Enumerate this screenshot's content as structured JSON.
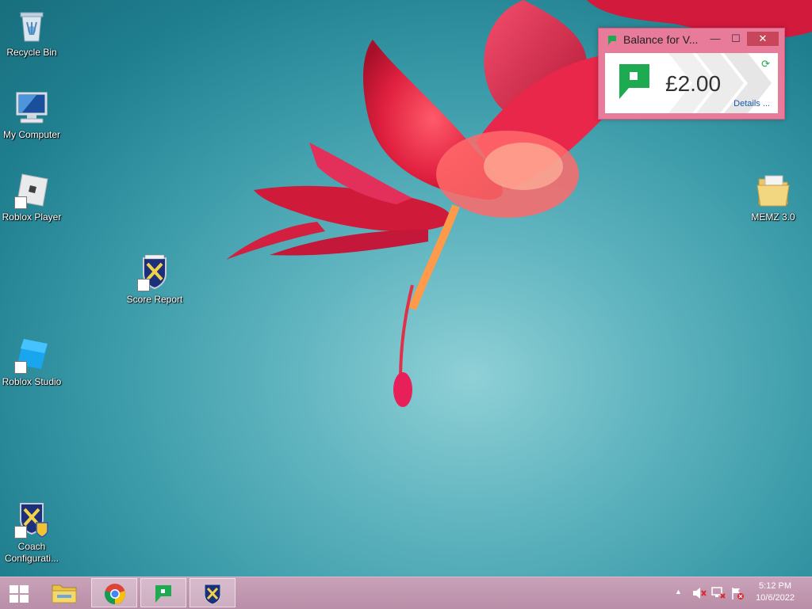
{
  "desktop": {
    "icons": [
      {
        "label": "Recycle Bin"
      },
      {
        "label": "My Computer"
      },
      {
        "label": "Roblox Player"
      },
      {
        "label": "Score Report"
      },
      {
        "label": "Roblox Studio"
      },
      {
        "label": "Coach Configurati..."
      },
      {
        "label": "MEMZ 3.0"
      }
    ]
  },
  "widget": {
    "title": "Balance for V...",
    "amount": "£2.00",
    "details_link": "Details ...",
    "minimize_glyph": "—",
    "maximize_glyph": "☐",
    "close_glyph": "✕",
    "accent_color": "#e87a9a",
    "brand_color": "#1eaa50"
  },
  "taskbar": {
    "items": [
      {
        "icon": "start-icon"
      },
      {
        "icon": "file-explorer-icon"
      },
      {
        "icon": "chrome-icon"
      },
      {
        "icon": "balance-app-icon",
        "active": true
      },
      {
        "icon": "score-report-icon"
      }
    ],
    "tray": {
      "overflow_glyph": "▲",
      "time": "5:12 PM",
      "date": "10/6/2022"
    }
  }
}
